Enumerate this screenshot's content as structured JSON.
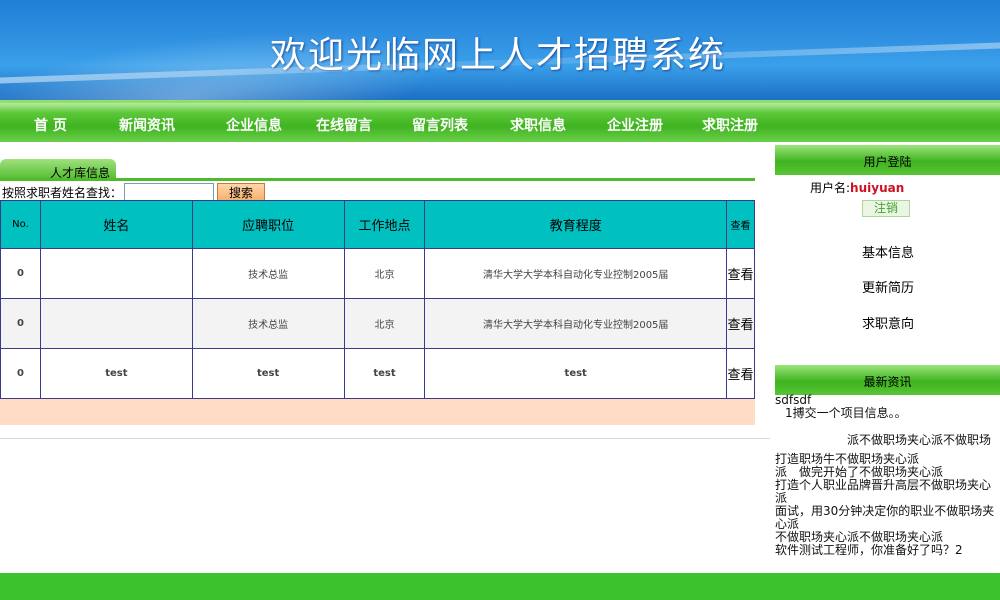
{
  "header": {
    "title": "欢迎光临网上人才招聘系统"
  },
  "nav": {
    "items": [
      "首 页",
      "新闻资讯",
      "企业信息",
      "在线留言",
      "留言列表",
      "求职信息",
      "企业注册",
      "求职注册"
    ]
  },
  "talent": {
    "tab_label": "人才库信息",
    "search_label": "按照求职者姓名查找：",
    "search_value": "",
    "search_button": "搜索",
    "columns": [
      "No.",
      "姓名",
      "应聘职位",
      "工作地点",
      "教育程度",
      "查看"
    ],
    "rows": [
      {
        "no": "0",
        "name": "",
        "position": "技术总监",
        "location": "北京",
        "education": "清华大学大学本科自动化专业控制2005届",
        "view": "查看"
      },
      {
        "no": "0",
        "name": "",
        "position": "技术总监",
        "location": "北京",
        "education": "清华大学大学本科自动化专业控制2005届",
        "view": "查看"
      },
      {
        "no": "0",
        "name": "test",
        "position": "test",
        "location": "test",
        "education": "test",
        "view": "查看"
      }
    ]
  },
  "sidebar": {
    "login_title": "用户登陆",
    "username_label": "用户名:",
    "username": "huiyuan",
    "logout_button": "注销",
    "links": [
      "基本信息",
      "更新简历",
      "求职意向"
    ],
    "news_title": "最新资讯",
    "news": [
      "sdfsdf",
      "1搏交一个项目信息。。",
      "派不做职场夹心派不做职场",
      "打造职场牛不做职场夹心派",
      "派　做完开始了不做职场夹心派",
      "打造个人职业品牌晋升高层不做职场夹心派",
      "面试，用30分钟决定你的职业不做职场夹心派",
      "不做职场夹心派不做职场夹心派",
      "软件测试工程师，你准备好了吗？2"
    ]
  },
  "colors": {
    "banner_blue": "#2e8ee0",
    "nav_green": "#3fb320",
    "table_header_teal": "#00c0c0",
    "strip_peach": "#ffdcc3",
    "username_red": "#d01020"
  }
}
